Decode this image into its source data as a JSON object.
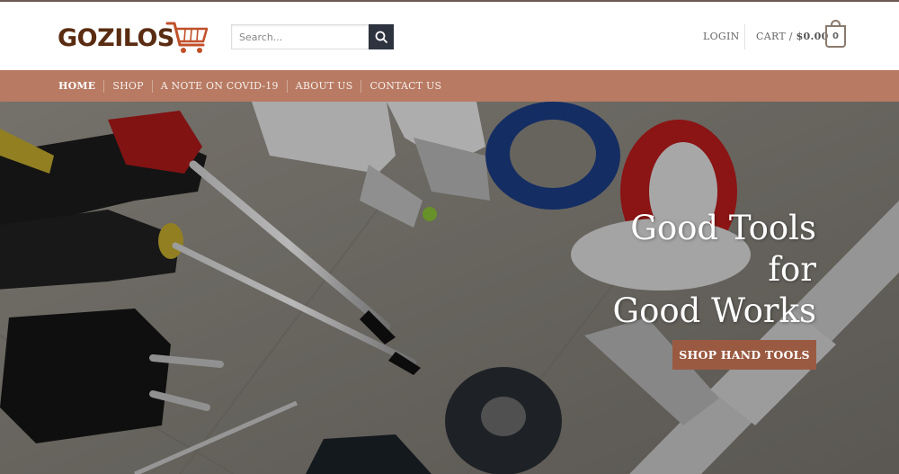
{
  "brand": {
    "name": "GOZILOS",
    "color": "#5a2c12",
    "accent": "#c0502a"
  },
  "search": {
    "placeholder": "Search..."
  },
  "header": {
    "login_label": "LOGIN",
    "cart_label": "CART /",
    "cart_amount": "$0.00",
    "cart_count": "0"
  },
  "nav": {
    "items": [
      {
        "label": "HOME",
        "active": true
      },
      {
        "label": "SHOP"
      },
      {
        "label": "A NOTE ON COVID-19"
      },
      {
        "label": "ABOUT US"
      },
      {
        "label": "CONTACT US"
      }
    ],
    "bg_color": "#b87a62"
  },
  "hero": {
    "title_lines": [
      "Good Tools",
      "for",
      "Good Works"
    ],
    "button_label": "SHOP HAND TOOLS",
    "button_color": "#9a5a42"
  }
}
